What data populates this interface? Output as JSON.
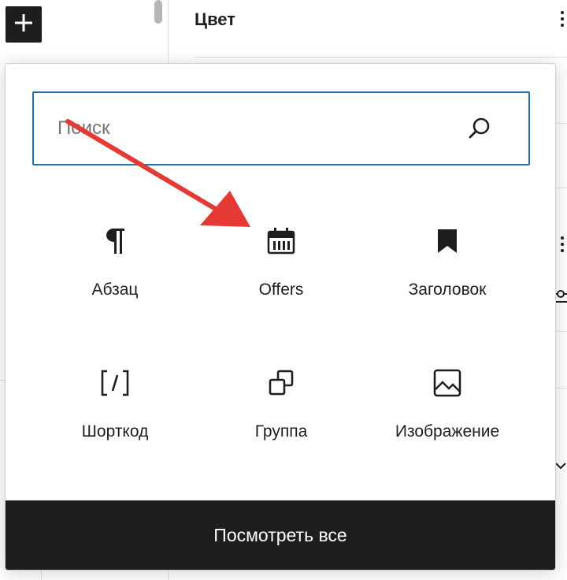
{
  "sidebar_panel": {
    "title": "Цвет"
  },
  "inserter": {
    "search": {
      "placeholder": "Поиск",
      "value": ""
    },
    "blocks": [
      {
        "label": "Абзац",
        "icon": "paragraph-icon"
      },
      {
        "label": "Offers",
        "icon": "calendar-icon"
      },
      {
        "label": "Заголовок",
        "icon": "bookmark-icon"
      },
      {
        "label": "Шорткод",
        "icon": "shortcode-icon"
      },
      {
        "label": "Группа",
        "icon": "group-icon"
      },
      {
        "label": "Изображение",
        "icon": "image-icon"
      }
    ],
    "browse_all_label": "Посмотреть все"
  },
  "annotation": {
    "arrow_color": "#e53935",
    "points_to": "Offers"
  },
  "colors": {
    "accent": "#2271b1",
    "dark": "#1e1e1e"
  }
}
